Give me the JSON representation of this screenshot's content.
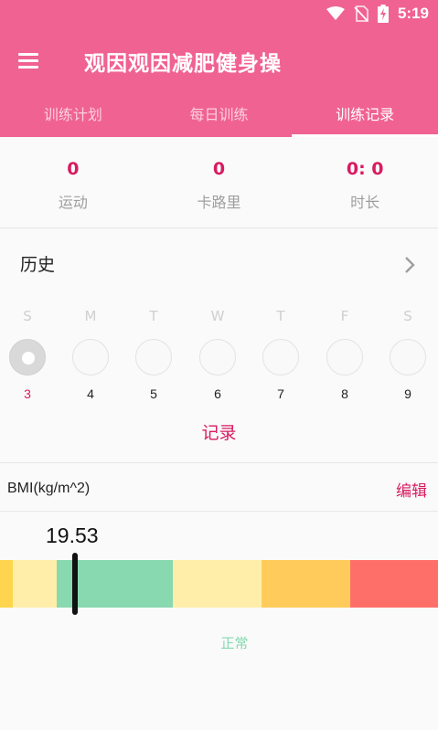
{
  "status_bar": {
    "time": "5:19"
  },
  "app": {
    "title": "观因观因减肥健身操"
  },
  "tabs": [
    {
      "label": "训练计划",
      "active": false
    },
    {
      "label": "每日训练",
      "active": false
    },
    {
      "label": "训练记录",
      "active": true
    }
  ],
  "stats": [
    {
      "value": "0",
      "label": "运动"
    },
    {
      "value": "0",
      "label": "卡路里"
    },
    {
      "value": "0: 0",
      "label": "时长"
    }
  ],
  "history": {
    "title": "历史",
    "days": [
      {
        "dow": "S",
        "num": "3",
        "today": true
      },
      {
        "dow": "M",
        "num": "4",
        "today": false
      },
      {
        "dow": "T",
        "num": "5",
        "today": false
      },
      {
        "dow": "W",
        "num": "6",
        "today": false
      },
      {
        "dow": "T",
        "num": "7",
        "today": false
      },
      {
        "dow": "F",
        "num": "8",
        "today": false
      },
      {
        "dow": "S",
        "num": "9",
        "today": false
      }
    ],
    "record_label": "记录"
  },
  "bmi": {
    "label": "BMI(kg/m^2)",
    "edit_label": "编辑",
    "value": 19.53,
    "value_text": "19.53",
    "status": "正常",
    "colors": {
      "accent": "#f06292",
      "accent_text": "#d81b60",
      "underweight": "#ffd54f",
      "light": "#ffeeaa",
      "normal": "#88d8b0",
      "overweight": "#ffcc5c",
      "obese": "#ff6f69"
    }
  }
}
